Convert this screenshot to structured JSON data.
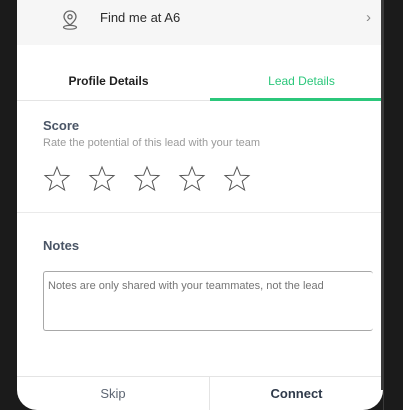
{
  "location": {
    "text": "Find me at A6",
    "icon": "map-pin-icon",
    "chevron": "›"
  },
  "tabs": [
    {
      "label": "Profile Details",
      "active": false
    },
    {
      "label": "Lead Details",
      "active": true
    }
  ],
  "colors": {
    "accent": "#2bc77b",
    "heading": "#4a5566",
    "muted": "#9a9a9a"
  },
  "score": {
    "title": "Score",
    "subtitle": "Rate the potential of this lead with your team",
    "rating": 0,
    "max": 5
  },
  "notes": {
    "title": "Notes",
    "placeholder": "Notes are only shared with your teammates, not the lead",
    "value": ""
  },
  "actions": {
    "skip_label": "Skip",
    "connect_label": "Connect"
  }
}
